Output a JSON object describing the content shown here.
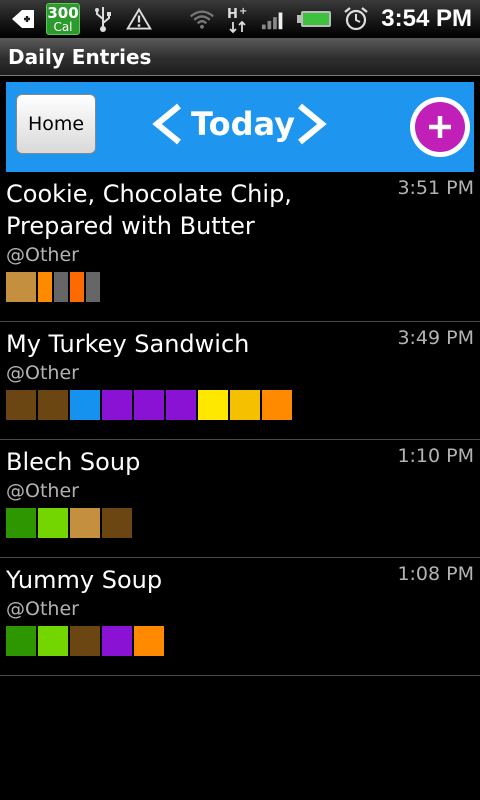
{
  "status_bar": {
    "cal_count": "300",
    "cal_unit": "Cal",
    "time": "3:54 PM",
    "icons": [
      "back-notification-icon",
      "usb-icon",
      "warning-icon",
      "wifi-icon",
      "hplus-data-icon",
      "signal-icon",
      "battery-icon",
      "alarm-icon"
    ]
  },
  "title_bar": {
    "title": "Daily Entries"
  },
  "nav": {
    "home_label": "Home",
    "day_label": "Today"
  },
  "colors": {
    "nav_blue": "#1e96f0",
    "add_magenta": "#c020b8"
  },
  "entries": [
    {
      "name": "Cookie, Chocolate Chip, Prepared with Butter",
      "time": "3:51 PM",
      "tag": "@Other",
      "swatches": [
        {
          "color": "#c48f3e",
          "w": 30
        },
        {
          "color": "#ff8a00",
          "w": 14
        },
        {
          "color": "#666666",
          "w": 14
        },
        {
          "color": "#ff6a00",
          "w": 14
        },
        {
          "color": "#666666",
          "w": 14
        }
      ]
    },
    {
      "name": "My Turkey Sandwich",
      "time": "3:49 PM",
      "tag": "@Other",
      "swatches": [
        {
          "color": "#6b4512",
          "w": 30
        },
        {
          "color": "#6b4512",
          "w": 30
        },
        {
          "color": "#1592f0",
          "w": 30
        },
        {
          "color": "#8a12d4",
          "w": 30
        },
        {
          "color": "#8a12d4",
          "w": 30
        },
        {
          "color": "#8a12d4",
          "w": 30
        },
        {
          "color": "#ffe800",
          "w": 30
        },
        {
          "color": "#f5c000",
          "w": 30
        },
        {
          "color": "#ff8a00",
          "w": 30
        }
      ]
    },
    {
      "name": "Blech Soup",
      "time": "1:10 PM",
      "tag": "@Other",
      "swatches": [
        {
          "color": "#2e9600",
          "w": 30
        },
        {
          "color": "#74d600",
          "w": 30
        },
        {
          "color": "#c48f3e",
          "w": 30
        },
        {
          "color": "#6b4512",
          "w": 30
        }
      ]
    },
    {
      "name": "Yummy Soup",
      "time": "1:08 PM",
      "tag": "@Other",
      "swatches": [
        {
          "color": "#2e9600",
          "w": 30
        },
        {
          "color": "#74d600",
          "w": 30
        },
        {
          "color": "#6b4512",
          "w": 30
        },
        {
          "color": "#8a12d4",
          "w": 30
        },
        {
          "color": "#ff8a00",
          "w": 30
        }
      ]
    }
  ]
}
